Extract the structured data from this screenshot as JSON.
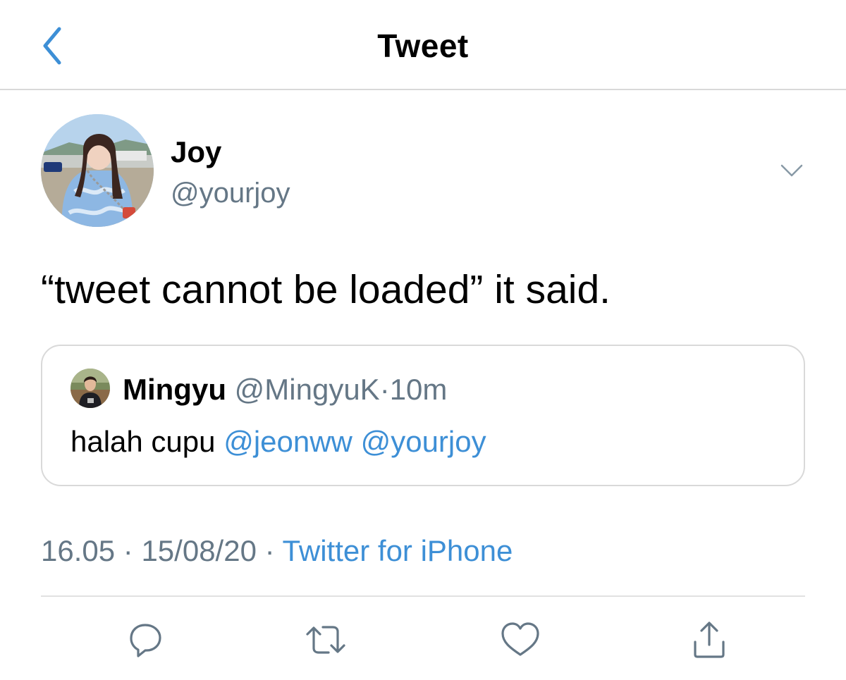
{
  "header": {
    "title": "Tweet",
    "back_icon": "chevron-left-icon"
  },
  "tweet": {
    "author_name": "Joy",
    "author_handle": "@yourjoy",
    "text": "“tweet cannot be loaded” it said.",
    "more_icon": "chevron-down-icon",
    "timestamp_time": "16.05",
    "timestamp_date": "15/08/20",
    "separator": "·",
    "source": "Twitter for iPhone"
  },
  "quoted_tweet": {
    "name": "Mingyu",
    "handle": "@MingyuK",
    "separator": "·",
    "time": "10m",
    "text_prefix": "halah cupu",
    "mentions": [
      "@jeonww",
      "@yourjoy"
    ]
  },
  "actions": [
    {
      "icon": "reply-icon"
    },
    {
      "icon": "retweet-icon"
    },
    {
      "icon": "like-icon"
    },
    {
      "icon": "share-icon"
    }
  ],
  "colors": {
    "accent": "#3d8fd6",
    "secondary_text": "#657786",
    "divider": "#d9d9d9",
    "icon_gray": "#657786"
  }
}
